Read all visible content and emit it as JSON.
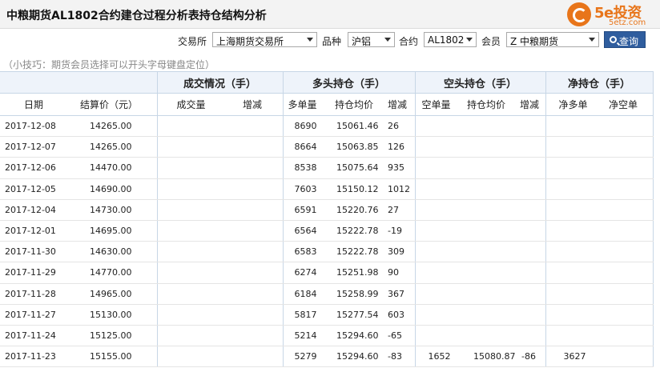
{
  "page_title": "中粮期货AL1802合约建仓过程分析表持仓结构分析",
  "logo": {
    "brand": "5e投资",
    "domain": "5etz.com"
  },
  "filters": {
    "exchange_label": "交易所",
    "exchange_value": "上海期货交易所",
    "product_label": "品种",
    "product_value": "沪铝",
    "contract_label": "合约",
    "contract_value": "AL1802",
    "member_label": "会员",
    "member_value": "Z 中粮期货",
    "query_button": "查询"
  },
  "tip": "（小技巧：期货会员选择可以开头字母键盘定位）",
  "table": {
    "groups": {
      "volume": "成交情况（手）",
      "long": "多头持仓（手）",
      "short": "空头持仓（手）",
      "net": "净持仓（手）"
    },
    "columns": {
      "date": "日期",
      "settle": "结算价（元）",
      "volume": "成交量",
      "volume_chg": "增减",
      "long": "多单量",
      "long_avg": "持仓均价",
      "long_chg": "增减",
      "short": "空单量",
      "short_avg": "持仓均价",
      "short_chg": "增减",
      "net_long": "净多单",
      "net_short": "净空单"
    },
    "rows": [
      {
        "date": "2017-12-08",
        "settle": "14265.00",
        "long": "8690",
        "long_avg": "15061.46",
        "long_chg": "26",
        "short": "",
        "short_avg": "",
        "short_chg": "",
        "net_long": "",
        "net_short": ""
      },
      {
        "date": "2017-12-07",
        "settle": "14265.00",
        "long": "8664",
        "long_avg": "15063.85",
        "long_chg": "126",
        "short": "",
        "short_avg": "",
        "short_chg": "",
        "net_long": "",
        "net_short": ""
      },
      {
        "date": "2017-12-06",
        "settle": "14470.00",
        "long": "8538",
        "long_avg": "15075.64",
        "long_chg": "935",
        "short": "",
        "short_avg": "",
        "short_chg": "",
        "net_long": "",
        "net_short": ""
      },
      {
        "date": "2017-12-05",
        "settle": "14690.00",
        "long": "7603",
        "long_avg": "15150.12",
        "long_chg": "1012",
        "short": "",
        "short_avg": "",
        "short_chg": "",
        "net_long": "",
        "net_short": ""
      },
      {
        "date": "2017-12-04",
        "settle": "14730.00",
        "long": "6591",
        "long_avg": "15220.76",
        "long_chg": "27",
        "short": "",
        "short_avg": "",
        "short_chg": "",
        "net_long": "",
        "net_short": ""
      },
      {
        "date": "2017-12-01",
        "settle": "14695.00",
        "long": "6564",
        "long_avg": "15222.78",
        "long_chg": "-19",
        "short": "",
        "short_avg": "",
        "short_chg": "",
        "net_long": "",
        "net_short": ""
      },
      {
        "date": "2017-11-30",
        "settle": "14630.00",
        "long": "6583",
        "long_avg": "15222.78",
        "long_chg": "309",
        "short": "",
        "short_avg": "",
        "short_chg": "",
        "net_long": "",
        "net_short": ""
      },
      {
        "date": "2017-11-29",
        "settle": "14770.00",
        "long": "6274",
        "long_avg": "15251.98",
        "long_chg": "90",
        "short": "",
        "short_avg": "",
        "short_chg": "",
        "net_long": "",
        "net_short": ""
      },
      {
        "date": "2017-11-28",
        "settle": "14965.00",
        "long": "6184",
        "long_avg": "15258.99",
        "long_chg": "367",
        "short": "",
        "short_avg": "",
        "short_chg": "",
        "net_long": "",
        "net_short": ""
      },
      {
        "date": "2017-11-27",
        "settle": "15130.00",
        "long": "5817",
        "long_avg": "15277.54",
        "long_chg": "603",
        "short": "",
        "short_avg": "",
        "short_chg": "",
        "net_long": "",
        "net_short": ""
      },
      {
        "date": "2017-11-24",
        "settle": "15125.00",
        "long": "5214",
        "long_avg": "15294.60",
        "long_chg": "-65",
        "short": "",
        "short_avg": "",
        "short_chg": "",
        "net_long": "",
        "net_short": ""
      },
      {
        "date": "2017-11-23",
        "settle": "15155.00",
        "long": "5279",
        "long_avg": "15294.60",
        "long_chg": "-83",
        "short": "1652",
        "short_avg": "15080.87",
        "short_chg": "-86",
        "net_long": "3627",
        "net_short": ""
      }
    ]
  },
  "colors": {
    "positive": "#d00000",
    "negative": "#008a00",
    "accent": "#2f5d9e",
    "brand": "#e8751a"
  }
}
